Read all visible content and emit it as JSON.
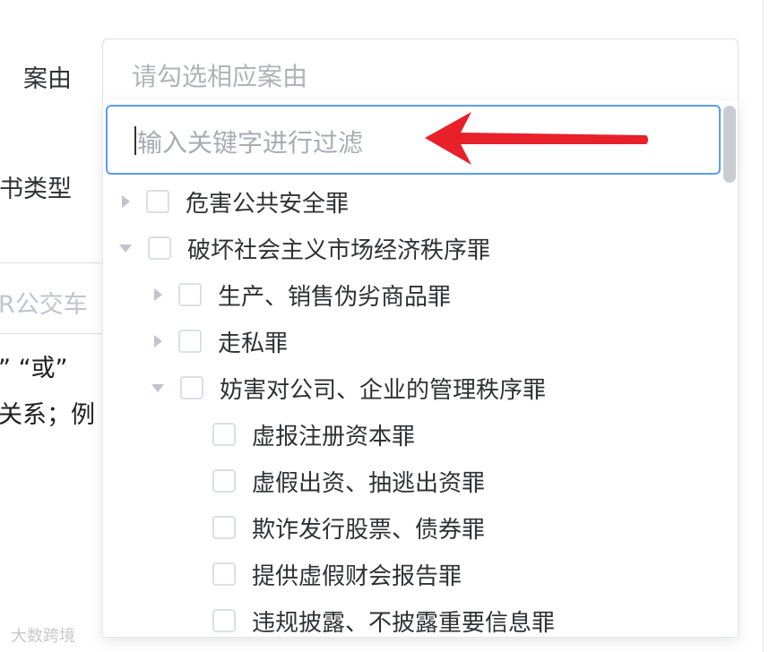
{
  "form": {
    "case_label": "案由",
    "doc_type_label": "书类型",
    "case_placeholder": "请勾选相应案由",
    "bg_input_text": "R公交车",
    "note_line1": "”  “或”",
    "note_line2": "关系；例"
  },
  "dropdown": {
    "filter_placeholder": "输入关键字进行过滤",
    "nodes": [
      {
        "label": "危害公共安全罪",
        "expanded": false
      },
      {
        "label": "破坏社会主义市场经济秩序罪",
        "expanded": true
      },
      {
        "label": "生产、销售伪劣商品罪",
        "expanded": false
      },
      {
        "label": "走私罪",
        "expanded": false
      },
      {
        "label": "妨害对公司、企业的管理秩序罪",
        "expanded": true
      },
      {
        "label": "虚报注册资本罪"
      },
      {
        "label": "虚假出资、抽逃出资罪"
      },
      {
        "label": "欺诈发行股票、债券罪"
      },
      {
        "label": "提供虚假财会报告罪"
      },
      {
        "label": "违规披露、不披露重要信息罪"
      }
    ]
  },
  "colors": {
    "accent": "#5a9cf0",
    "annotation_arrow": "#e8202a"
  },
  "watermark": "大数跨境"
}
